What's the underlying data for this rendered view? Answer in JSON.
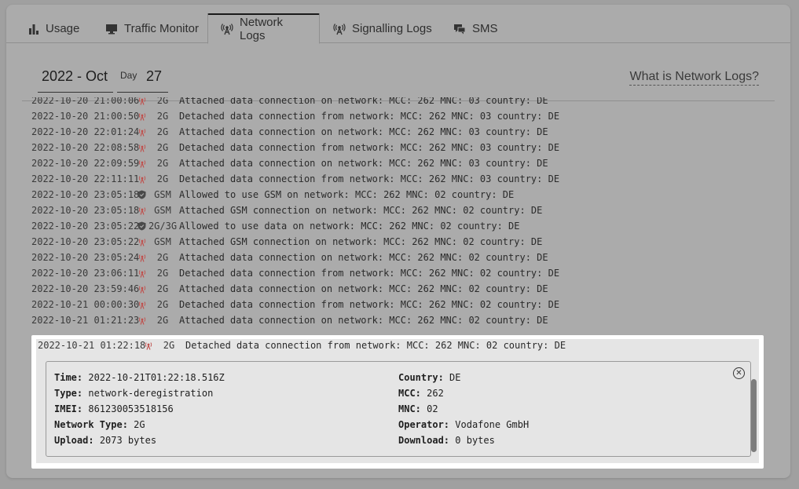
{
  "tabs": [
    {
      "label": "Usage",
      "icon": "bar-chart-icon",
      "active": false
    },
    {
      "label": "Traffic Monitor",
      "icon": "monitor-icon",
      "active": false
    },
    {
      "label": "Network Logs",
      "icon": "antenna-icon",
      "active": true
    },
    {
      "label": "Signalling Logs",
      "icon": "antenna-icon",
      "active": false
    },
    {
      "label": "SMS",
      "icon": "chat-icon",
      "active": false
    }
  ],
  "filters": {
    "month": "2022 - Oct",
    "day_label": "Day",
    "day_value": "27"
  },
  "help_link": "What is Network Logs?",
  "colors": {
    "antenna_red": "#c0504d",
    "shield_dark": "#4a4a4a",
    "highlight_bg": "#ffffff",
    "detail_bg": "#e5e5e5"
  },
  "log_rows": [
    {
      "ts": "2022-10-20 21:00:06",
      "icon": "antenna-icon",
      "net": "2G",
      "msg": "Attached data connection on network: MCC: 262 MNC: 03 country: DE"
    },
    {
      "ts": "2022-10-20 21:00:50",
      "icon": "antenna-icon",
      "net": "2G",
      "msg": "Detached data connection from network: MCC: 262 MNC: 03 country: DE"
    },
    {
      "ts": "2022-10-20 22:01:24",
      "icon": "antenna-icon",
      "net": "2G",
      "msg": "Attached data connection on network: MCC: 262 MNC: 03 country: DE"
    },
    {
      "ts": "2022-10-20 22:08:58",
      "icon": "antenna-icon",
      "net": "2G",
      "msg": "Detached data connection from network: MCC: 262 MNC: 03 country: DE"
    },
    {
      "ts": "2022-10-20 22:09:59",
      "icon": "antenna-icon",
      "net": "2G",
      "msg": "Attached data connection on network: MCC: 262 MNC: 03 country: DE"
    },
    {
      "ts": "2022-10-20 22:11:11",
      "icon": "antenna-icon",
      "net": "2G",
      "msg": "Detached data connection from network: MCC: 262 MNC: 03 country: DE"
    },
    {
      "ts": "2022-10-20 23:05:18",
      "icon": "shield-icon",
      "net": "GSM",
      "msg": "Allowed to use GSM on network: MCC: 262 MNC: 02 country: DE"
    },
    {
      "ts": "2022-10-20 23:05:18",
      "icon": "antenna-icon",
      "net": "GSM",
      "msg": "Attached GSM connection on network: MCC: 262 MNC: 02 country: DE"
    },
    {
      "ts": "2022-10-20 23:05:22",
      "icon": "shield-icon",
      "net": "2G/3G",
      "msg": "Allowed to use data on network: MCC: 262 MNC: 02 country: DE"
    },
    {
      "ts": "2022-10-20 23:05:22",
      "icon": "antenna-icon",
      "net": "GSM",
      "msg": "Attached GSM connection on network: MCC: 262 MNC: 02 country: DE"
    },
    {
      "ts": "2022-10-20 23:05:24",
      "icon": "antenna-icon",
      "net": "2G",
      "msg": "Attached data connection on network: MCC: 262 MNC: 02 country: DE"
    },
    {
      "ts": "2022-10-20 23:06:11",
      "icon": "antenna-icon",
      "net": "2G",
      "msg": "Detached data connection from network: MCC: 262 MNC: 02 country: DE"
    },
    {
      "ts": "2022-10-20 23:59:46",
      "icon": "antenna-icon",
      "net": "2G",
      "msg": "Attached data connection on network: MCC: 262 MNC: 02 country: DE"
    },
    {
      "ts": "2022-10-21 00:00:30",
      "icon": "antenna-icon",
      "net": "2G",
      "msg": "Detached data connection from network: MCC: 262 MNC: 02 country: DE"
    },
    {
      "ts": "2022-10-21 01:21:23",
      "icon": "antenna-icon",
      "net": "2G",
      "msg": "Attached data connection on network: MCC: 262 MNC: 02 country: DE"
    }
  ],
  "selected_row": {
    "ts": "2022-10-21 01:22:18",
    "icon": "antenna-icon",
    "net": "2G",
    "msg": "Detached data connection from network: MCC: 262 MNC: 02 country: DE"
  },
  "detail": {
    "left": [
      {
        "key": "Time:",
        "value": "2022-10-21T01:22:18.516Z"
      },
      {
        "key": "Type:",
        "value": "network-deregistration"
      },
      {
        "key": "IMEI:",
        "value": "861230053518156"
      },
      {
        "key": "Network Type:",
        "value": "2G"
      },
      {
        "key": "Upload:",
        "value": "2073 bytes"
      }
    ],
    "right": [
      {
        "key": "Country:",
        "value": "DE"
      },
      {
        "key": "MCC:",
        "value": "262"
      },
      {
        "key": "MNC:",
        "value": "02"
      },
      {
        "key": "Operator:",
        "value": "Vodafone GmbH"
      },
      {
        "key": "Download:",
        "value": "0 bytes"
      }
    ]
  }
}
